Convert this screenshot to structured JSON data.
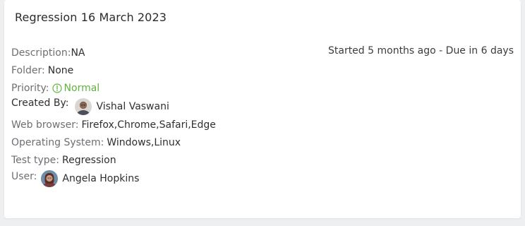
{
  "card": {
    "title": "Regression 16 March 2023",
    "status": "Started 5 months ago - Due in 6 days"
  },
  "fields": {
    "description_label": "Description:",
    "description_value": "NA",
    "folder_label": "Folder:",
    "folder_value": "None",
    "priority_label": "Priority:",
    "priority_value": "Normal",
    "created_by_label": "Created By:",
    "created_by_value": "Vishal Vaswani",
    "browser_label": "Web browser:",
    "browser_value": "Firefox,Chrome,Safari,Edge",
    "os_label": "Operating System:",
    "os_value": "Windows,Linux",
    "test_type_label": "Test type:",
    "test_type_value": "Regression",
    "user_label": "User:",
    "user_value": "Angela Hopkins"
  },
  "colors": {
    "priority_normal": "#62b33b",
    "label_gray": "#6c6f73",
    "text_dark": "#2f2f2f",
    "background": "#eeeff1"
  },
  "icons": {
    "priority_icon": "info-circle-icon",
    "creator_avatar": "avatar",
    "user_avatar": "avatar"
  }
}
